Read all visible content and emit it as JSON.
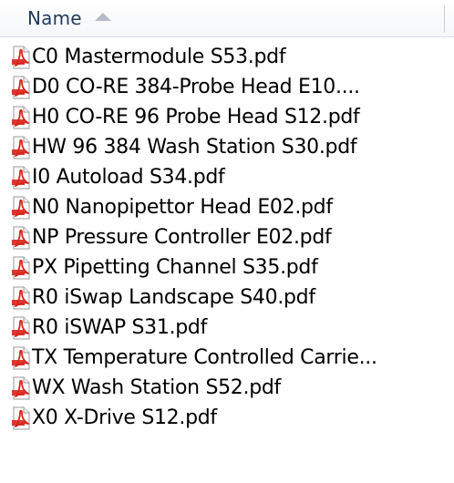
{
  "header": {
    "name_label": "Name",
    "sort_icon": "sort-ascending-icon"
  },
  "files": [
    {
      "name": "C0 Mastermodule S53.pdf",
      "icon": "pdf-icon"
    },
    {
      "name": "D0 CO-RE 384-Probe Head E10....",
      "icon": "pdf-icon"
    },
    {
      "name": "H0 CO-RE 96 Probe Head S12.pdf",
      "icon": "pdf-icon"
    },
    {
      "name": "HW 96 384 Wash Station S30.pdf",
      "icon": "pdf-icon"
    },
    {
      "name": "I0 Autoload S34.pdf",
      "icon": "pdf-icon"
    },
    {
      "name": "N0 Nanopipettor Head E02.pdf",
      "icon": "pdf-icon"
    },
    {
      "name": "NP Pressure Controller E02.pdf",
      "icon": "pdf-icon"
    },
    {
      "name": "PX Pipetting Channel S35.pdf",
      "icon": "pdf-icon"
    },
    {
      "name": "R0 iSwap Landscape S40.pdf",
      "icon": "pdf-icon"
    },
    {
      "name": "R0 iSWAP S31.pdf",
      "icon": "pdf-icon"
    },
    {
      "name": "TX Temperature Controlled Carrie...",
      "icon": "pdf-icon"
    },
    {
      "name": "WX Wash Station S52.pdf",
      "icon": "pdf-icon"
    },
    {
      "name": "X0 X-Drive S12.pdf",
      "icon": "pdf-icon"
    }
  ],
  "colors": {
    "header_text": "#1e395b",
    "pdf_red": "#d8251c"
  }
}
